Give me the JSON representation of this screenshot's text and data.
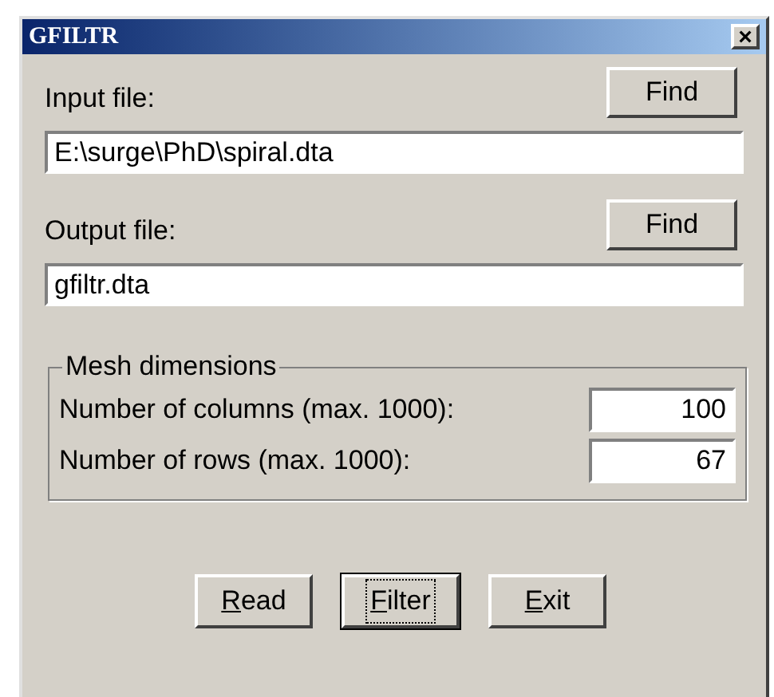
{
  "window": {
    "title": "GFILTR",
    "close": "×"
  },
  "input": {
    "label": "Input file:",
    "button": "Find",
    "value": "E:\\surge\\PhD\\spiral.dta"
  },
  "output": {
    "label": "Output file:",
    "button": "Find",
    "value": "gfiltr.dta"
  },
  "mesh": {
    "title": "Mesh dimensions",
    "fields": [
      {
        "label": "Number of columns (max. 1000):",
        "value": "100"
      },
      {
        "label": "Number of rows (max. 1000):",
        "value": "67"
      }
    ]
  },
  "buttons": [
    {
      "access_key": "R",
      "rest": "ead",
      "focused": false
    },
    {
      "access_key": "F",
      "rest": "ilter",
      "focused": true
    },
    {
      "access_key": "E",
      "rest": "xit",
      "focused": false
    }
  ]
}
